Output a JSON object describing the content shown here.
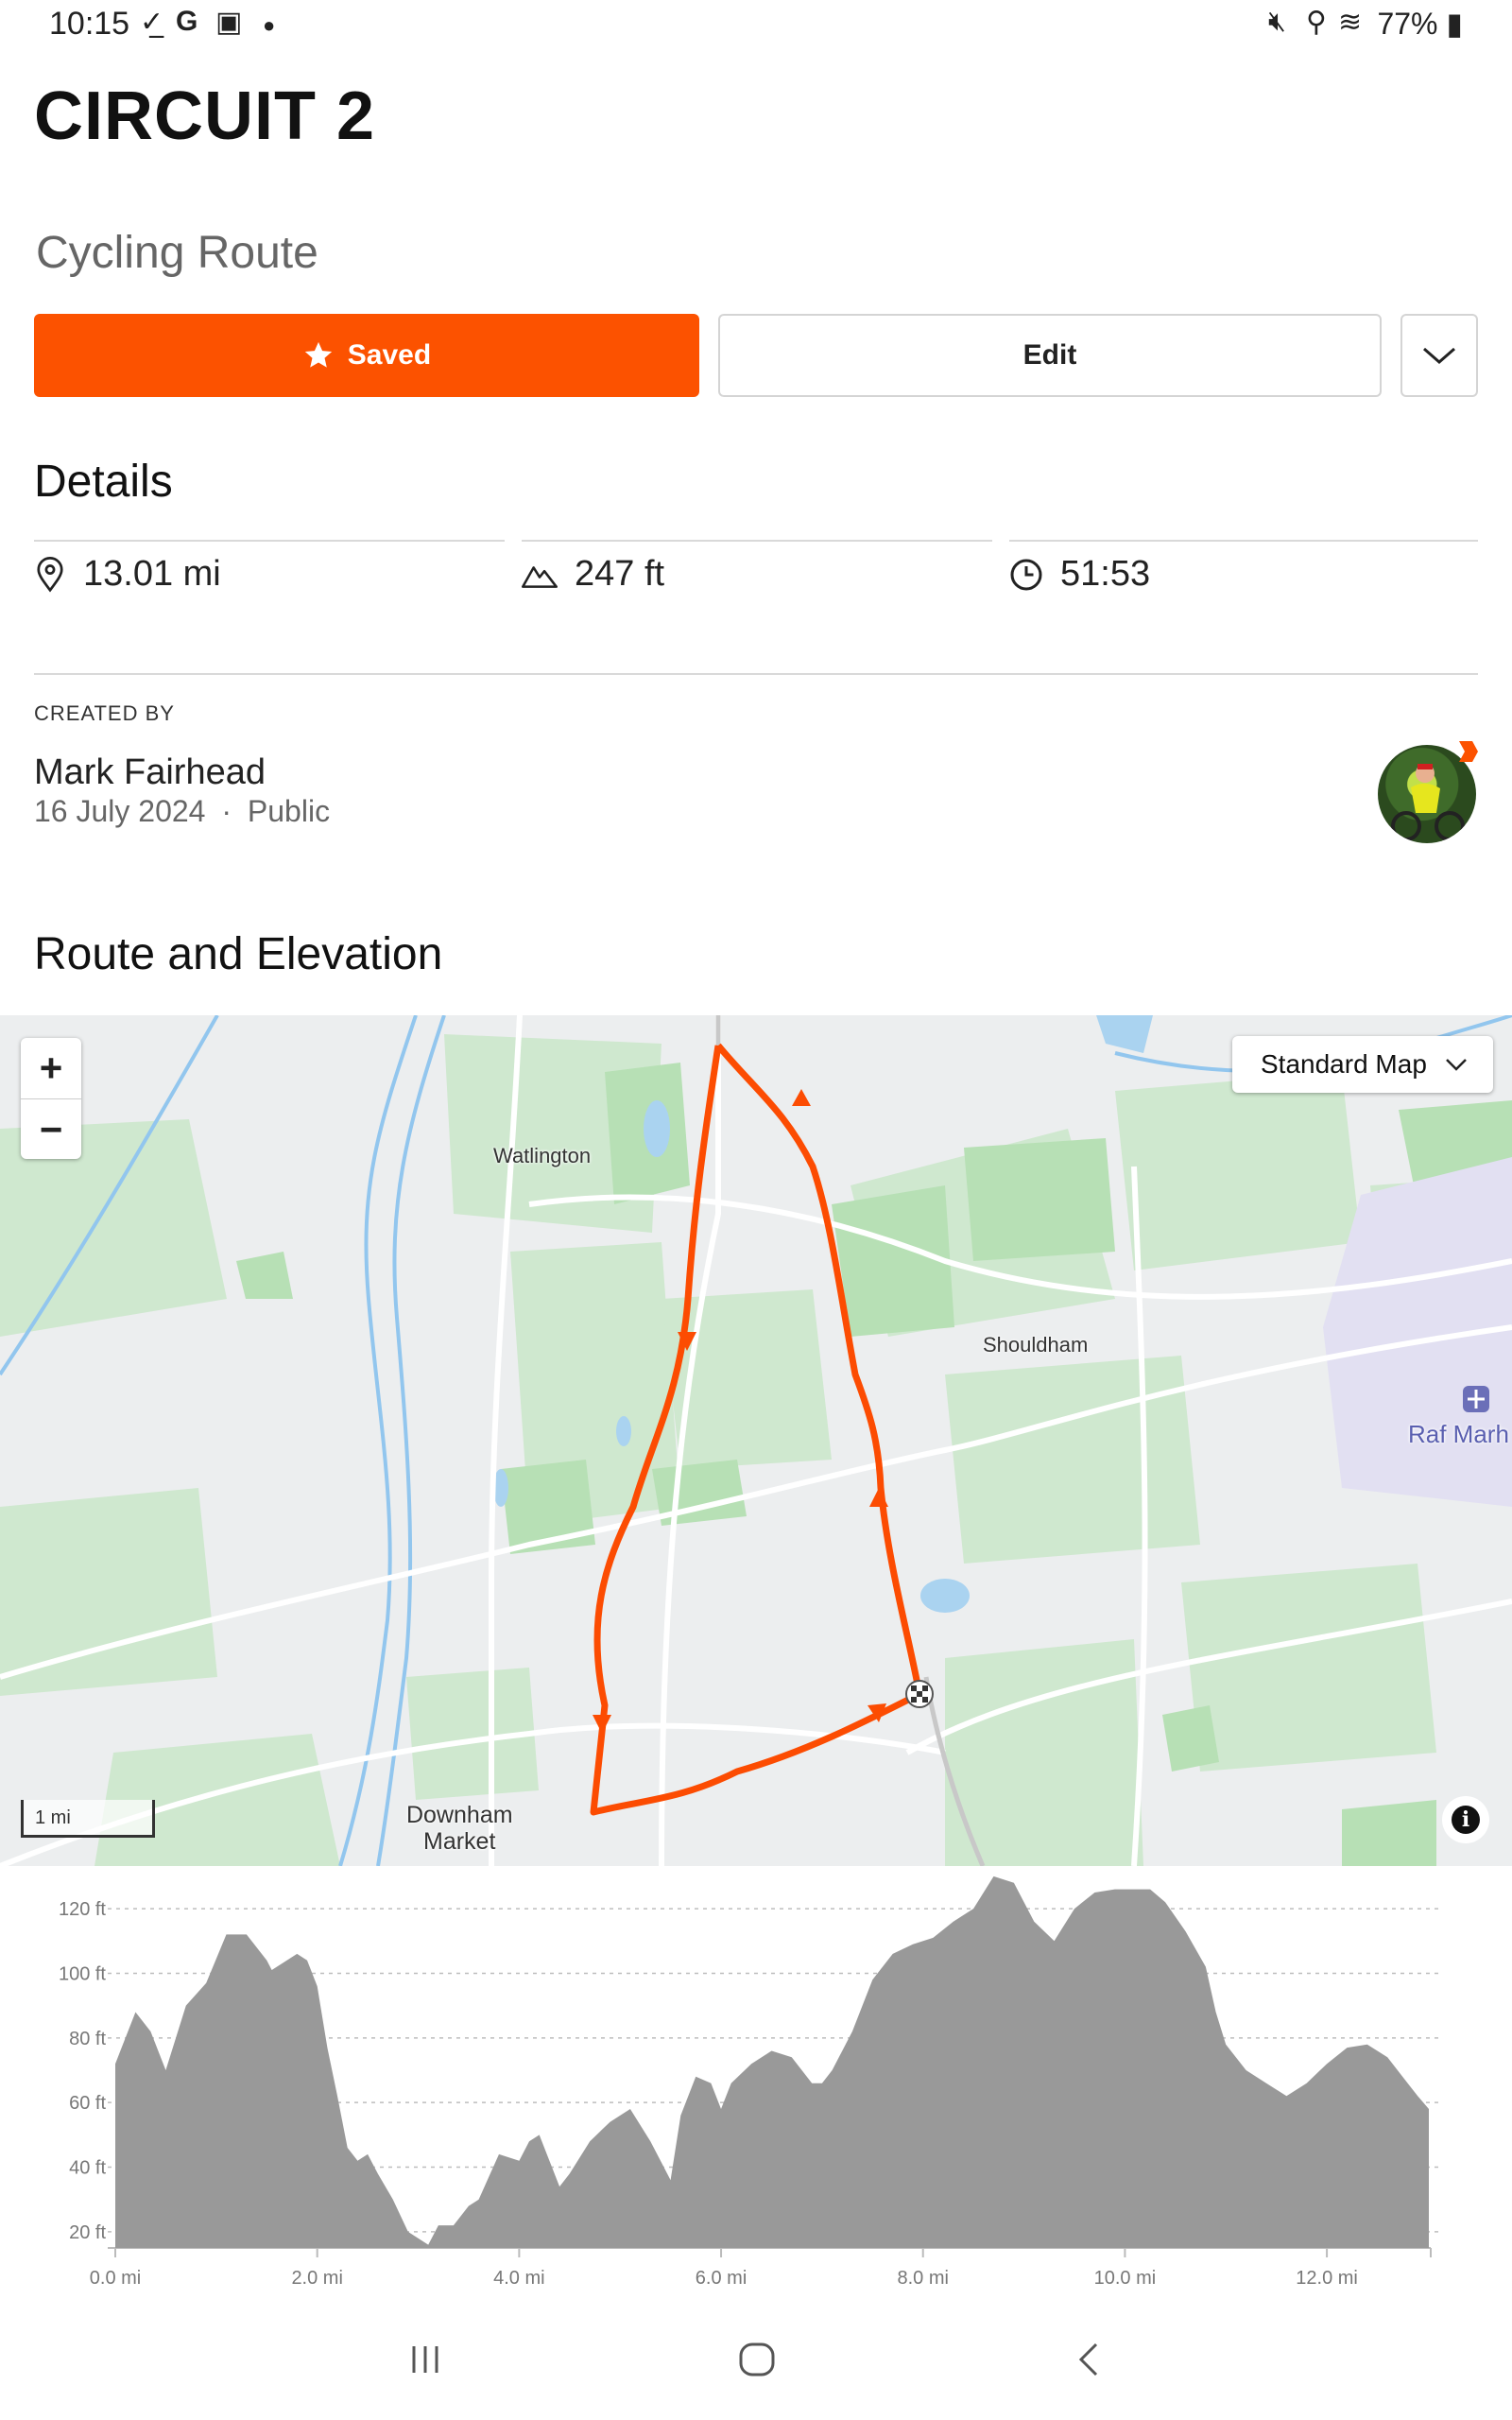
{
  "status_bar": {
    "time": "10:15",
    "left_icons": [
      "check-download-icon",
      "google-icon",
      "gallery-icon",
      "dot-icon"
    ],
    "right_icons": [
      "mute-icon",
      "location-icon",
      "wifi-icon",
      "battery-icon"
    ],
    "battery": "77%"
  },
  "route": {
    "title": "CIRCUIT 2",
    "subtitle": "Cycling Route"
  },
  "actions": {
    "saved_label": "Saved",
    "edit_label": "Edit"
  },
  "details": {
    "heading": "Details",
    "distance": "13.01 mi",
    "elevation": "247 ft",
    "time": "51:53"
  },
  "creator": {
    "label": "CREATED BY",
    "name": "Mark Fairhead",
    "date": "16 July 2024",
    "separator": "·",
    "visibility": "Public"
  },
  "route_section": {
    "heading": "Route and Elevation"
  },
  "map": {
    "zoom_in": "+",
    "zoom_out": "−",
    "map_type": "Standard Map",
    "labels": {
      "watlington": "Watlington",
      "shouldham": "Shouldham",
      "downham1": "Downham",
      "downham2": "Market",
      "raf": "Raf Marh"
    },
    "scale": "1 mi",
    "info": "i",
    "route_color": "#fc4c02"
  },
  "chart_data": {
    "type": "area",
    "x_tick_labels": [
      "0.0 mi",
      "2.0 mi",
      "4.0 mi",
      "6.0 mi",
      "8.0 mi",
      "10.0 mi",
      "12.0 mi"
    ],
    "y_tick_labels": [
      "120 ft",
      "100 ft",
      "80 ft",
      "60 ft",
      "40 ft",
      "20 ft"
    ],
    "xlim": [
      0,
      13.01
    ],
    "ylim": [
      15,
      125
    ],
    "grid": true,
    "color": "#999999",
    "x": [
      0.0,
      0.2,
      0.35,
      0.5,
      0.7,
      0.9,
      1.1,
      1.3,
      1.5,
      1.55,
      1.7,
      1.8,
      1.9,
      2.0,
      2.1,
      2.2,
      2.3,
      2.4,
      2.5,
      2.6,
      2.75,
      2.9,
      3.0,
      3.1,
      3.2,
      3.35,
      3.5,
      3.6,
      3.7,
      3.8,
      4.0,
      4.1,
      4.2,
      4.3,
      4.4,
      4.5,
      4.7,
      4.9,
      5.1,
      5.3,
      5.5,
      5.6,
      5.75,
      5.9,
      6.0,
      6.1,
      6.3,
      6.5,
      6.7,
      6.9,
      7.0,
      7.1,
      7.3,
      7.5,
      7.7,
      7.9,
      8.1,
      8.3,
      8.5,
      8.7,
      8.9,
      9.1,
      9.3,
      9.5,
      9.7,
      9.9,
      10.1,
      10.25,
      10.4,
      10.6,
      10.8,
      10.9,
      11.0,
      11.2,
      11.4,
      11.6,
      11.8,
      12.0,
      12.2,
      12.4,
      12.6,
      12.8,
      12.9,
      13.01
    ],
    "values": [
      72,
      88,
      82,
      70,
      90,
      97,
      112,
      112,
      104,
      101,
      104,
      106,
      104,
      96,
      77,
      62,
      46,
      42,
      44,
      38,
      30,
      20,
      18,
      16,
      22,
      22,
      28,
      30,
      37,
      44,
      42,
      48,
      50,
      42,
      34,
      38,
      48,
      54,
      58,
      48,
      36,
      56,
      68,
      66,
      58,
      66,
      72,
      76,
      74,
      66,
      66,
      70,
      82,
      98,
      106,
      109,
      111,
      116,
      120,
      130,
      128,
      116,
      110,
      120,
      125,
      126,
      126,
      126,
      122,
      113,
      102,
      88,
      78,
      70,
      66,
      62,
      66,
      72,
      77,
      78,
      74,
      66,
      62,
      58
    ]
  },
  "nav_bar": {
    "recents": "recents-icon",
    "home": "home-icon",
    "back": "back-icon"
  }
}
